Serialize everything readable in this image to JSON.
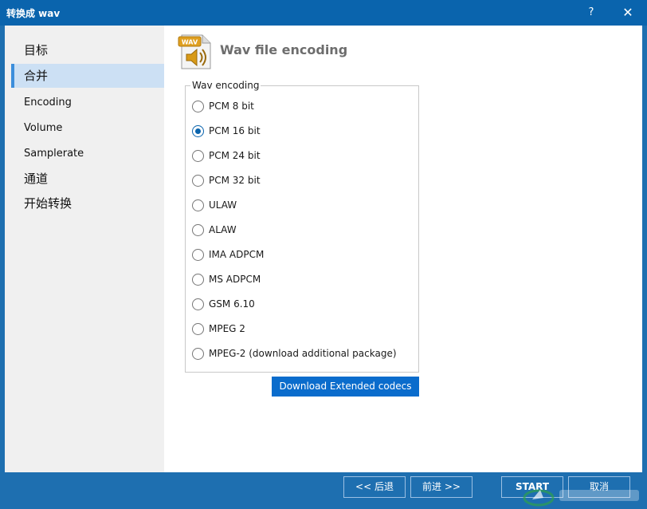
{
  "window": {
    "title": "转换成 wav",
    "help_glyph": "?",
    "close_glyph": "✕"
  },
  "sidebar": {
    "items": [
      {
        "label": "目标"
      },
      {
        "label": "合并"
      },
      {
        "label": "Encoding"
      },
      {
        "label": "Volume"
      },
      {
        "label": "Samplerate"
      },
      {
        "label": "通道"
      },
      {
        "label": "开始转换"
      }
    ],
    "active_index": 1
  },
  "page": {
    "icon": "wav-file-icon",
    "icon_text": "WAV",
    "title": "Wav file encoding"
  },
  "encoding_group": {
    "legend": "Wav encoding",
    "options": [
      {
        "label": "PCM 8 bit",
        "checked": false
      },
      {
        "label": "PCM 16 bit",
        "checked": true
      },
      {
        "label": "PCM 24 bit",
        "checked": false
      },
      {
        "label": "PCM 32 bit",
        "checked": false
      },
      {
        "label": "ULAW",
        "checked": false
      },
      {
        "label": "ALAW",
        "checked": false
      },
      {
        "label": "IMA ADPCM",
        "checked": false
      },
      {
        "label": "MS ADPCM",
        "checked": false
      },
      {
        "label": "GSM 6.10",
        "checked": false
      },
      {
        "label": "MPEG 2",
        "checked": false
      },
      {
        "label": "MPEG-2 (download additional package)",
        "checked": false
      }
    ]
  },
  "download_button": {
    "label": "Download Extended codecs"
  },
  "footer": {
    "back_label": "<< 后退",
    "next_label": "前进 >>",
    "start_label": "START",
    "cancel_label": "取消"
  },
  "colors": {
    "titlebar": "#0a64ad",
    "footer": "#1e6fb0",
    "sidebar": "#f0f0f0",
    "active_item": "#cce0f4",
    "accent": "#0a6ccc"
  }
}
